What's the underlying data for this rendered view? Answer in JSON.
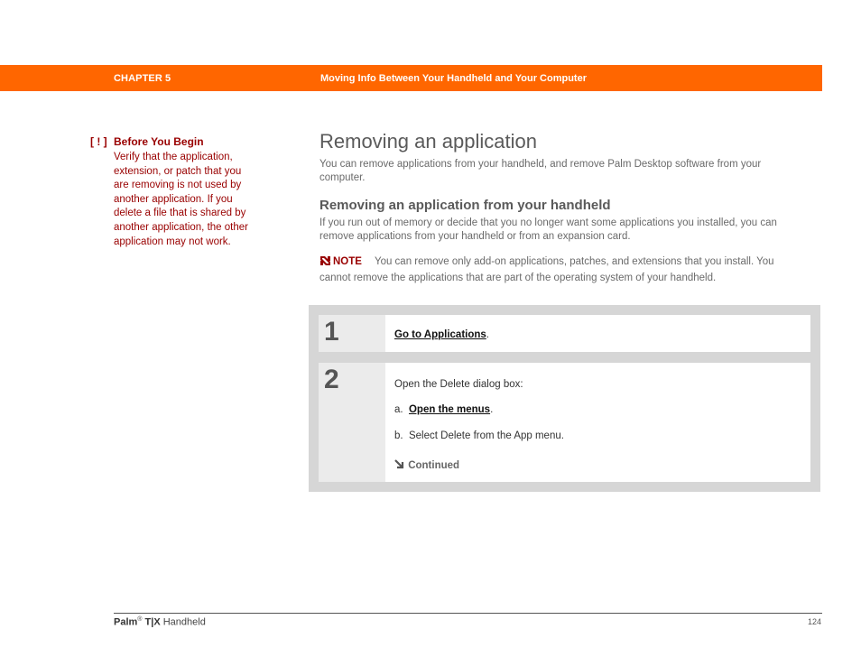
{
  "header": {
    "chapter": "CHAPTER 5",
    "title": "Moving Info Between Your Handheld and Your Computer",
    "bar_color": "#ff6600"
  },
  "sidebar": {
    "icon": "[ ! ]",
    "heading": "Before You Begin",
    "body": "Verify that the application, extension, or patch that you are removing is not used by another application. If you delete a file that is shared by another application, the other application may not work.",
    "color": "#990000"
  },
  "main": {
    "title": "Removing an application",
    "intro": "You can remove applications from your handheld, and remove Palm Desktop software from your computer.",
    "subheading": "Removing an application from your handheld",
    "subintro": "If you run out of memory or decide that you no longer want some applications you installed, you can remove applications from your handheld or from an expansion card.",
    "note": {
      "icon": "note-icon",
      "label": "NOTE",
      "text": "You can remove only add-on applications, patches, and extensions that you install. You cannot remove the applications that are part of the operating system of your handheld."
    }
  },
  "steps": [
    {
      "number": "1",
      "link": "Go to Applications",
      "suffix": "."
    },
    {
      "number": "2",
      "text": "Open the Delete dialog box:",
      "substeps": [
        {
          "marker": "a.",
          "link": "Open the menus",
          "suffix": "."
        },
        {
          "marker": "b.",
          "text": "Select Delete from the App menu."
        }
      ],
      "continued": "Continued"
    }
  ],
  "footer": {
    "brand": "Palm",
    "reg": "®",
    "model": "T|X",
    "product": "Handheld",
    "page": "124"
  }
}
